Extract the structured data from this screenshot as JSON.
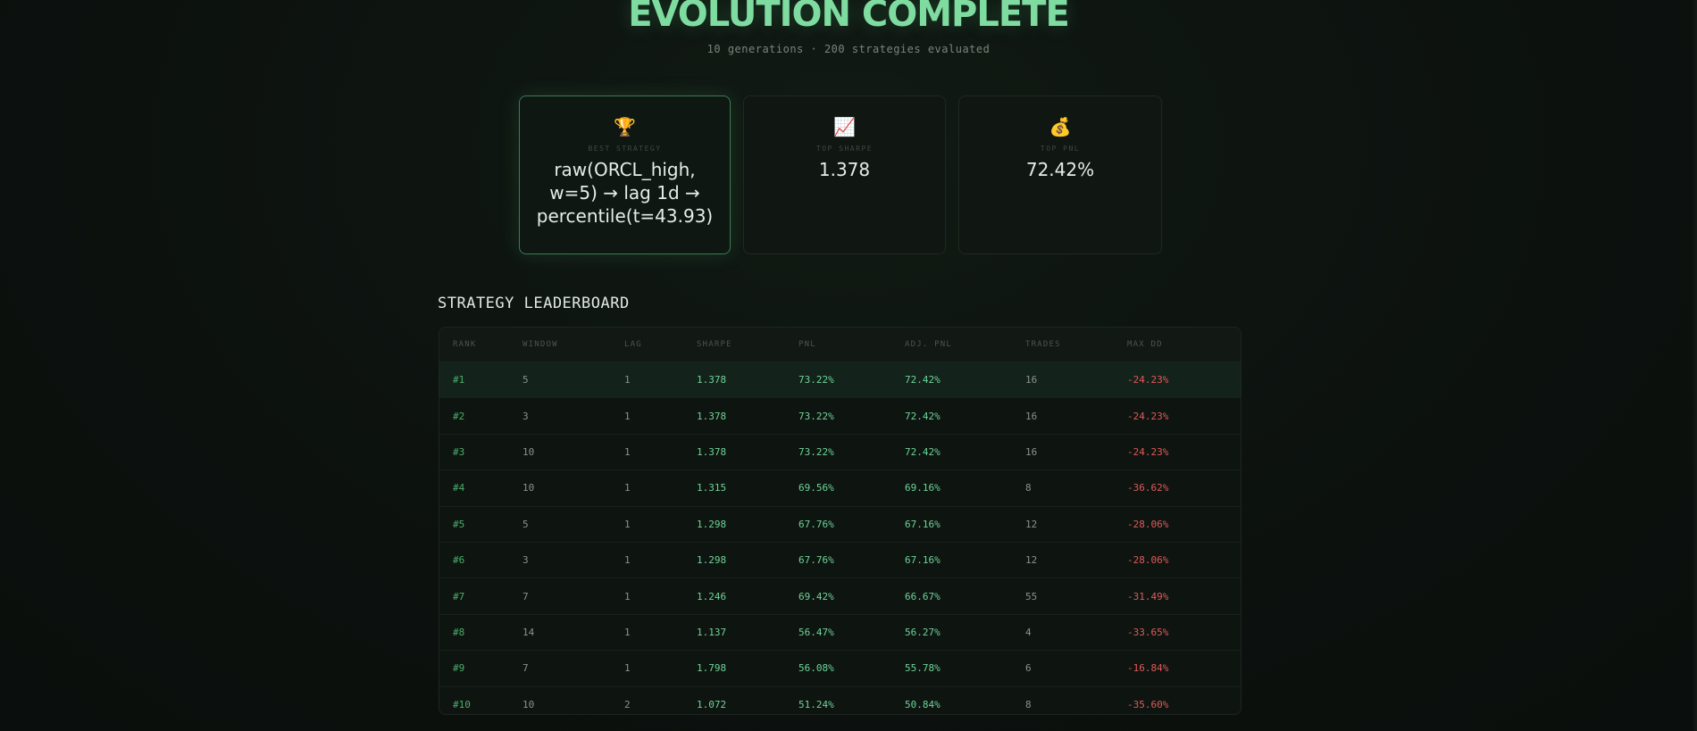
{
  "hero": {
    "title": "EVOLUTION COMPLETE",
    "subtitle": "10 generations · 200 strategies evaluated"
  },
  "cards": {
    "best": {
      "icon": "trophy-icon",
      "glyph": "🏆",
      "label": "BEST STRATEGY",
      "value": "raw(ORCL_high, w=5) → lag 1d → percentile(t=43.93)"
    },
    "sharpe": {
      "icon": "chart-increasing-icon",
      "glyph": "📈",
      "label": "TOP SHARPE",
      "value": "1.378"
    },
    "pnl": {
      "icon": "money-bag-icon",
      "glyph": "💰",
      "label": "TOP PnL",
      "value": "72.42%"
    }
  },
  "leaderboard": {
    "title": "STRATEGY LEADERBOARD",
    "columns": [
      "RANK",
      "WINDOW",
      "LAG",
      "SHARPE",
      "PnL",
      "ADJ. PnL",
      "TRADES",
      "MAX DD"
    ],
    "rows": [
      {
        "rank": "#1",
        "window": "5",
        "lag": "1",
        "sharpe": "1.378",
        "pnl": "73.22%",
        "adj_pnl": "72.42%",
        "trades": "16",
        "max_dd": "-24.23%"
      },
      {
        "rank": "#2",
        "window": "3",
        "lag": "1",
        "sharpe": "1.378",
        "pnl": "73.22%",
        "adj_pnl": "72.42%",
        "trades": "16",
        "max_dd": "-24.23%"
      },
      {
        "rank": "#3",
        "window": "10",
        "lag": "1",
        "sharpe": "1.378",
        "pnl": "73.22%",
        "adj_pnl": "72.42%",
        "trades": "16",
        "max_dd": "-24.23%"
      },
      {
        "rank": "#4",
        "window": "10",
        "lag": "1",
        "sharpe": "1.315",
        "pnl": "69.56%",
        "adj_pnl": "69.16%",
        "trades": "8",
        "max_dd": "-36.62%"
      },
      {
        "rank": "#5",
        "window": "5",
        "lag": "1",
        "sharpe": "1.298",
        "pnl": "67.76%",
        "adj_pnl": "67.16%",
        "trades": "12",
        "max_dd": "-28.06%"
      },
      {
        "rank": "#6",
        "window": "3",
        "lag": "1",
        "sharpe": "1.298",
        "pnl": "67.76%",
        "adj_pnl": "67.16%",
        "trades": "12",
        "max_dd": "-28.06%"
      },
      {
        "rank": "#7",
        "window": "7",
        "lag": "1",
        "sharpe": "1.246",
        "pnl": "69.42%",
        "adj_pnl": "66.67%",
        "trades": "55",
        "max_dd": "-31.49%"
      },
      {
        "rank": "#8",
        "window": "14",
        "lag": "1",
        "sharpe": "1.137",
        "pnl": "56.47%",
        "adj_pnl": "56.27%",
        "trades": "4",
        "max_dd": "-33.65%"
      },
      {
        "rank": "#9",
        "window": "7",
        "lag": "1",
        "sharpe": "1.798",
        "pnl": "56.08%",
        "adj_pnl": "55.78%",
        "trades": "6",
        "max_dd": "-16.84%"
      },
      {
        "rank": "#10",
        "window": "10",
        "lag": "2",
        "sharpe": "1.072",
        "pnl": "51.24%",
        "adj_pnl": "50.84%",
        "trades": "8",
        "max_dd": "-35.60%"
      }
    ]
  },
  "colors": {
    "accent": "#7fdca0",
    "positive": "#6fd49a",
    "negative": "#e05a5a",
    "rank": "#4cae6c"
  }
}
